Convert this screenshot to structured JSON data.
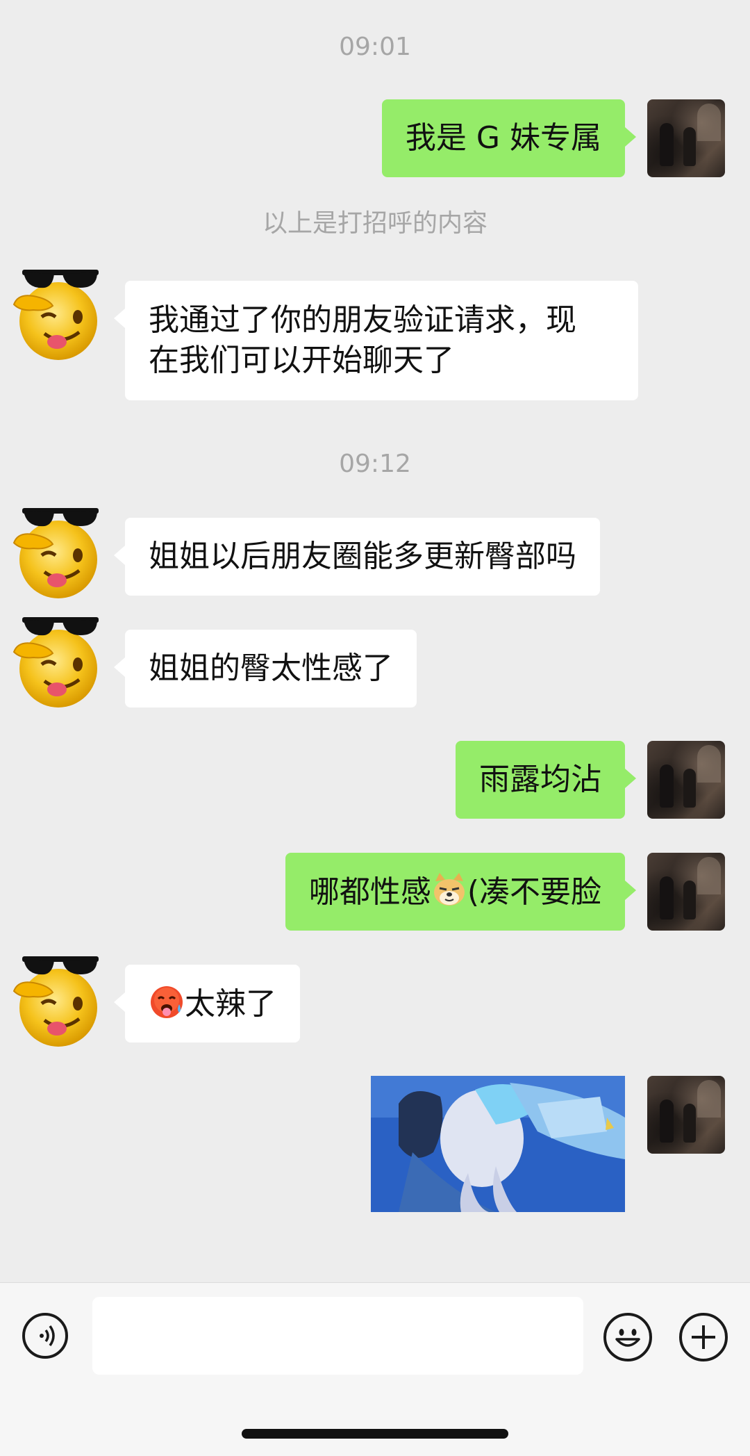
{
  "chat": {
    "timestamps": [
      "09:01",
      "09:12"
    ],
    "system_notice": "以上是打招呼的内容",
    "messages": [
      {
        "from": "me",
        "text": "我是 G 妹专属"
      },
      {
        "from": "friend",
        "line1": "我通过了你的朋友验证请求，现",
        "line2": "在我们可以开始聊天了"
      },
      {
        "from": "friend",
        "text": "姐姐以后朋友圈能多更新臀部吗"
      },
      {
        "from": "friend",
        "text": "姐姐的臀太性感了"
      },
      {
        "from": "me",
        "text": "雨露均沾"
      },
      {
        "from": "me",
        "text_before": "哪都性感",
        "emoji": "doge-emoji",
        "text_after": "(凑不要脸"
      },
      {
        "from": "friend",
        "emoji": "hot-face-emoji",
        "text_after": "太辣了"
      },
      {
        "from": "me",
        "image": "anime-image"
      }
    ]
  },
  "input_bar": {
    "voice_icon": "voice-icon",
    "emoji_icon": "smiley-icon",
    "more_icon": "plus-icon",
    "text_value": ""
  },
  "colors": {
    "background": "#ededed",
    "outgoing_bubble": "#95ec69",
    "incoming_bubble": "#ffffff",
    "timestamp_text": "#a6a6a6"
  }
}
